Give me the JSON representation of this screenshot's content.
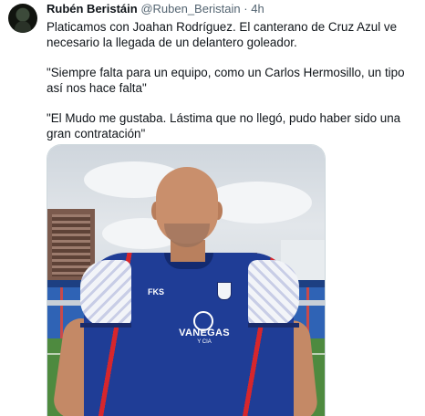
{
  "tweet": {
    "author_name": "Rubén Beristáin",
    "author_handle": "@Ruben_Beristain",
    "separator": "·",
    "timestamp": "4h",
    "paragraphs": [
      "Platicamos con Joahan Rodríguez. El canterano de Cruz Azul ve necesario la llegada de un delantero goleador.",
      "\"Siempre falta para un equipo, como un Carlos Hermosillo, un tipo así nos hace falta\"",
      "\"El Mudo me gustaba. Lástima que no llegó, pudo haber sido una gran contratación\""
    ],
    "media": {
      "shirt_sponsor": "VANEGAS",
      "shirt_sponsor_sub": "Y CIA",
      "shirt_brand": "FKS"
    }
  }
}
